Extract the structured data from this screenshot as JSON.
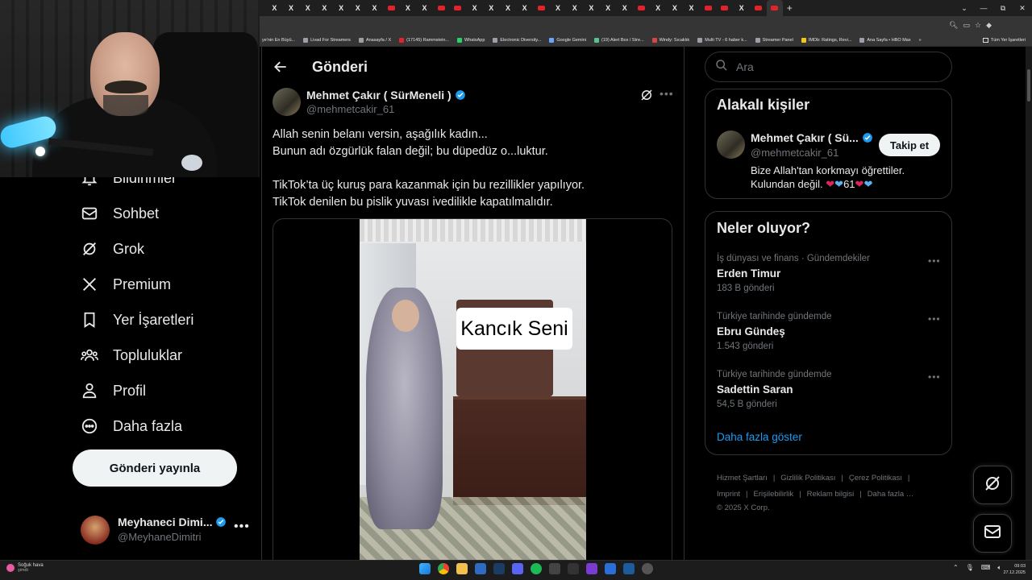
{
  "browser": {
    "tabs": [
      "X",
      "X",
      "X",
      "X",
      "X",
      "X",
      "X",
      "",
      "X",
      "X",
      "",
      "",
      "X",
      "X",
      "X",
      "X",
      "",
      "X",
      "X",
      "X",
      "X",
      "X",
      "",
      "X",
      "X",
      "X",
      "",
      "",
      "X",
      "",
      ""
    ],
    "new_tab": "+",
    "window_controls": [
      "—",
      "⧉",
      "✕",
      "⌄"
    ],
    "bookmarks": [
      "ye'nin En Büyü...",
      "Livad For Streamers",
      "Anasayfa / X",
      "(17145) Rammstein...",
      "WhatsApp",
      "Electronic Diversity...",
      "Google Gemini",
      "(19) Alert Box / Stre...",
      "Windy: Sıcaklık",
      "Multi TV - 6 haber k...",
      "Streamer Panel",
      "IMDb: Ratings, Revi...",
      "Ana Sayfa • HBO Max"
    ],
    "bookmarks_overflow": "»",
    "all_bookmarks": "Tüm Yer İşaretleri"
  },
  "nav": {
    "items": [
      {
        "label": "Bildirimler",
        "icon": "bell-icon"
      },
      {
        "label": "Sohbet",
        "icon": "envelope-icon"
      },
      {
        "label": "Grok",
        "icon": "grok-icon"
      },
      {
        "label": "Premium",
        "icon": "x-logo-icon"
      },
      {
        "label": "Yer İşaretleri",
        "icon": "bookmark-icon"
      },
      {
        "label": "Topluluklar",
        "icon": "communities-icon"
      },
      {
        "label": "Profil",
        "icon": "person-icon"
      },
      {
        "label": "Daha fazla",
        "icon": "more-circle-icon"
      }
    ],
    "post_button": "Gönderi yayınla",
    "me": {
      "name": "Meyhaneci Dimi...",
      "handle": "@MeyhaneDimitri",
      "more": "•••"
    }
  },
  "main": {
    "title": "Gönderi",
    "tweet": {
      "author_name": "Mehmet Çakır ( SürMeneli )",
      "author_handle": "@mehmetcakir_61",
      "more": "•••",
      "lines": [
        "Allah senin belanı versin, aşağılık kadın...",
        "Bunun adı özgürlük falan değil; bu düpedüz o...luktur.",
        "TikTok’ta üç kuruş para kazanmak için bu rezillikler yapılıyor.",
        "TikTok denilen bu pislik yuvası ivedilikle kapatılmalıdır."
      ],
      "video_caption": "Kancık Seni"
    }
  },
  "sidebar": {
    "search_placeholder": "Ara",
    "related": {
      "title": "Alakalı kişiler",
      "name": "Mehmet Çakır ( Sü...",
      "handle": "@mehmetcakir_61",
      "follow": "Takip et",
      "bio_line1": "Bize Allah'tan korkmayı öğrettiler.",
      "bio_line2_text": "Kulundan değil.",
      "bio_line2_number": "61"
    },
    "trends": {
      "title": "Neler oluyor?",
      "items": [
        {
          "context": "İş dünyası ve finans · Gündemdekiler",
          "name": "Erden Timur",
          "count": "183 B gönderi"
        },
        {
          "context": "Türkiye tarihinde gündemde",
          "name": "Ebru Gündeş",
          "count": "1.543 gönderi"
        },
        {
          "context": "Türkiye tarihinde gündemde",
          "name": "Sadettin Saran",
          "count": "54,5 B gönderi"
        }
      ],
      "more_dots": "•••",
      "show_more": "Daha fazla göster"
    },
    "footer": {
      "links": [
        "Hizmet Şartları",
        "|",
        "Gizlilik Politikası",
        "|",
        "Çerez Politikası",
        "|",
        "Imprint",
        "|",
        "Erişilebilirlik",
        "|",
        "Reklam bilgisi",
        "|",
        "Daha fazla …"
      ],
      "copyright": "© 2025 X Corp."
    }
  },
  "taskbar": {
    "weather_title": "Soğuk hava",
    "weather_sub": "şimdi",
    "time": "09:03",
    "date": "27.12.2025"
  },
  "colors": {
    "accent": "#1d9bf0",
    "verified": "#1d9bf0",
    "background": "#000000",
    "border": "#2f3336"
  }
}
